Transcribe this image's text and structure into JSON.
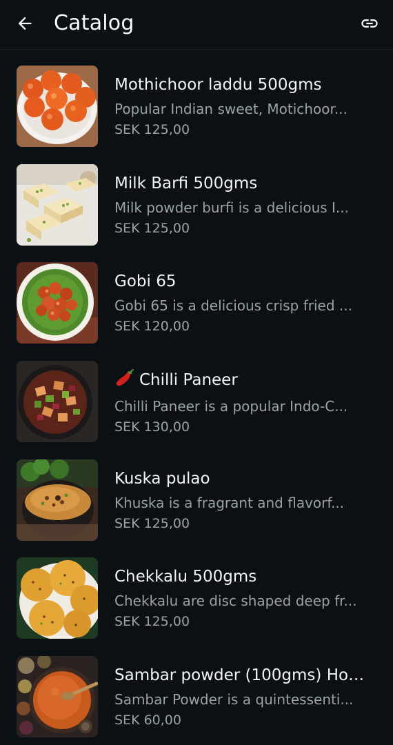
{
  "header": {
    "title": "Catalog",
    "back_icon": "arrow-left-icon",
    "link_icon": "link-icon"
  },
  "items": [
    {
      "name": "Mothichoor laddu 500gms",
      "description": "Popular Indian sweet, Motichoor...",
      "price": "SEK 125,00",
      "image": "laddu"
    },
    {
      "name": "Milk Barfi 500gms",
      "description": "Milk powder burfi is a delicious I...",
      "price": "SEK 125,00",
      "image": "barfi"
    },
    {
      "name": "Gobi 65",
      "description": "Gobi 65 is a delicious crisp fried ...",
      "price": "SEK 120,00",
      "image": "gobi"
    },
    {
      "name": "Chilli Paneer",
      "description": "Chilli Paneer is a popular Indo-C...",
      "price": "SEK 130,00",
      "image": "paneer",
      "emoji": "chili-pepper-icon"
    },
    {
      "name": "Kuska pulao",
      "description": "Khuska is a fragrant and flavorf...",
      "price": "SEK 125,00",
      "image": "pulao"
    },
    {
      "name": "Chekkalu 500gms",
      "description": "Chekkalu are disc shaped deep fr...",
      "price": "SEK 125,00",
      "image": "chekkalu"
    },
    {
      "name": "Sambar powder (100gms) Hom...",
      "description": "Sambar Powder is a quintessenti...",
      "price": "SEK 60,00",
      "image": "sambar"
    }
  ],
  "colors": {
    "background": "#0b1014",
    "primary_text": "#f2f4f5",
    "secondary_text": "#9aa3a8"
  }
}
